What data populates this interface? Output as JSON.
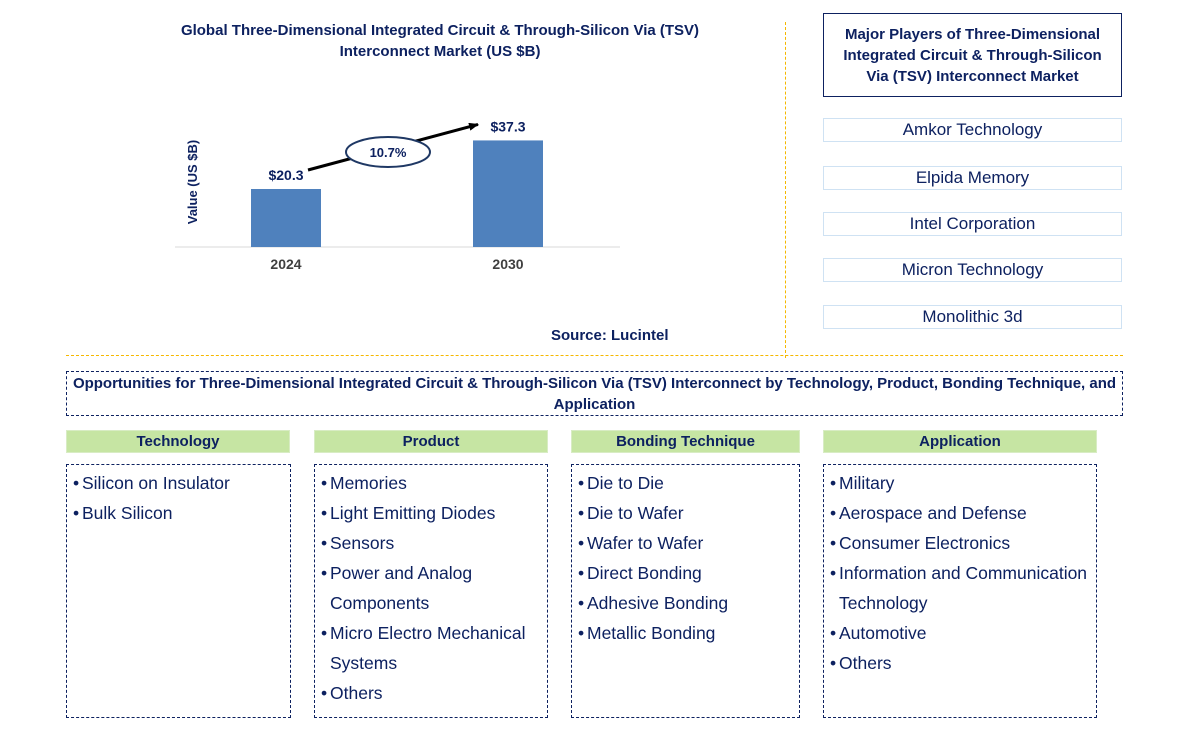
{
  "chart_data": {
    "type": "bar",
    "title": "Global Three-Dimensional Integrated Circuit & Through-Silicon Via (TSV) Interconnect Market (US $B)",
    "categories": [
      "2024",
      "2030"
    ],
    "values": [
      20.3,
      37.3
    ],
    "data_labels": [
      "$20.3",
      "$37.3"
    ],
    "xlabel": "",
    "ylabel": "Value (US $B)",
    "ylim": [
      0,
      42
    ],
    "grid": false,
    "annotation": {
      "type": "cagr-arrow",
      "label": "10.7%"
    },
    "bar_color": "#4f81bd",
    "source": "Source: Lucintel"
  },
  "players": {
    "title": "Major Players of Three-Dimensional Integrated Circuit & Through-Silicon Via (TSV) Interconnect Market",
    "items": [
      "Amkor Technology",
      "Elpida Memory",
      "Intel Corporation",
      "Micron Technology",
      "Monolithic 3d"
    ]
  },
  "opportunities": {
    "title": "Opportunities for Three-Dimensional Integrated Circuit & Through-Silicon Via (TSV) Interconnect by Technology, Product, Bonding Technique, and Application",
    "bullet": "•",
    "categories": [
      {
        "label": "Technology",
        "items": [
          "Silicon on Insulator",
          "Bulk Silicon"
        ]
      },
      {
        "label": "Product",
        "items": [
          "Memories",
          "Light Emitting Diodes",
          "Sensors",
          "Power and Analog Components",
          "Micro Electro Mechanical Systems",
          "Others"
        ]
      },
      {
        "label": "Bonding Technique",
        "items": [
          "Die to Die",
          "Die to Wafer",
          "Wafer to Wafer",
          "Direct Bonding",
          "Adhesive Bonding",
          "Metallic Bonding"
        ]
      },
      {
        "label": "Application",
        "items": [
          "Military",
          "Aerospace and Defense",
          "Consumer Electronics",
          "Information and Communication Technology",
          "Automotive",
          "Others"
        ]
      }
    ]
  },
  "colors": {
    "text": "#0d2160",
    "bar": "#4f81bd",
    "category_header": "#c6e5a3",
    "divider": "#f5b800",
    "axis_tick": "#404040"
  }
}
